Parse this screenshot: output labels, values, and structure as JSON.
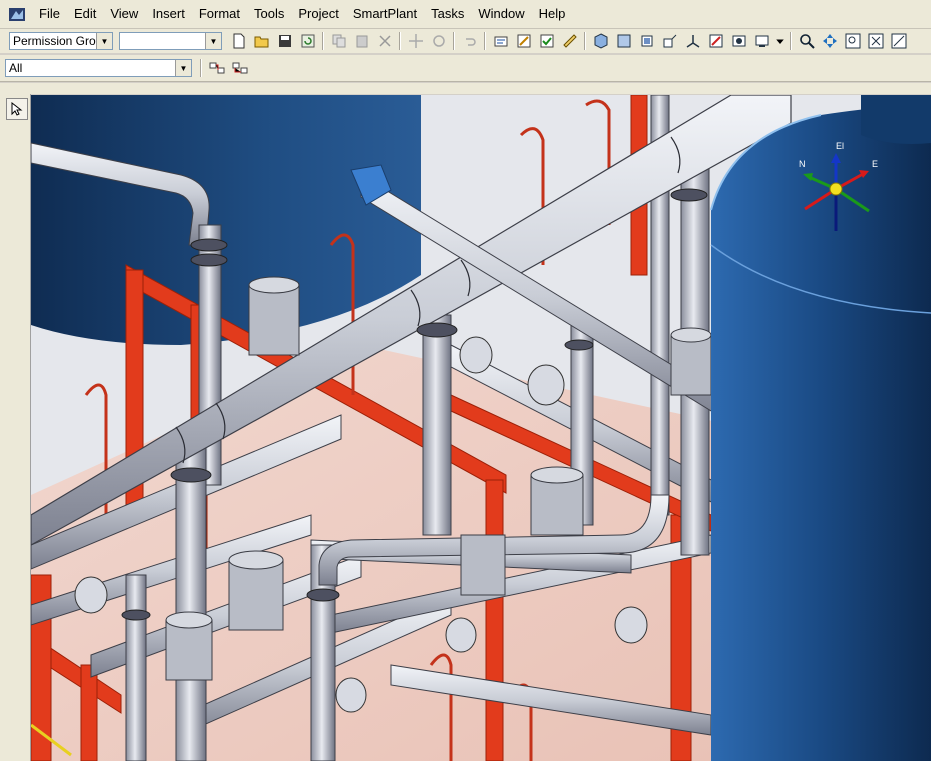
{
  "menu": {
    "items": [
      "File",
      "Edit",
      "View",
      "Insert",
      "Format",
      "Tools",
      "Project",
      "SmartPlant",
      "Tasks",
      "Window",
      "Help"
    ]
  },
  "toolbar": {
    "permission_group": "Permission Grou",
    "second_combo": "",
    "filter_combo": "All"
  },
  "compass": {
    "north": "N",
    "east": "E",
    "elevation": "El"
  },
  "colors": {
    "steel_red": "#e23b1c",
    "pipe_gray": "#c9cdd6",
    "vessel_blue": "#1f4d82"
  }
}
